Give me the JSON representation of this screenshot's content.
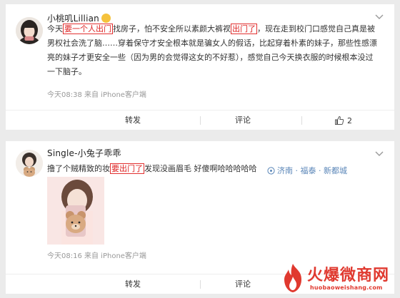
{
  "post1": {
    "username": "小桃叽Lillian",
    "line1": {
      "a": "今天",
      "m1": "要一个人出门",
      "b": "找房子，怕不安全所以素颜大裤衩",
      "m2": "出门了",
      "c": "，现在走到校门口感觉自己真是被"
    },
    "line2": "男权社会洗了脑……穿着保守才安全根本就是骗女人的假话，比起穿着朴素的妹子，那些性感漂",
    "line3": "亮的妹子才更安全一些（因为男的会觉得这女的不好惹），感觉自己今天换衣服的时候根本没过",
    "line4": "一下脑子。",
    "time": "今天08:38 来自 iPhone客户端",
    "share_label": "转发",
    "comment_label": "评论",
    "like_count": "2"
  },
  "post2": {
    "username": "Single-小兔子乖乖",
    "text": {
      "a": "撸了个贼精致的妆",
      "m1": "要出门了",
      "b": "发现没画眉毛 好傻啊哈哈哈哈哈"
    },
    "location": "济南 · 福泰 · 新都城",
    "time": "今天08:16 来自 iPhone客户端",
    "share_label": "转发",
    "comment_label": "评论"
  },
  "watermark": {
    "text_cn": "火爆微商网",
    "text_en": "huobaoweishang.com",
    "color": "#e0392f"
  },
  "colors": {
    "highlight_border": "#e23030",
    "link": "#5a86b8"
  }
}
